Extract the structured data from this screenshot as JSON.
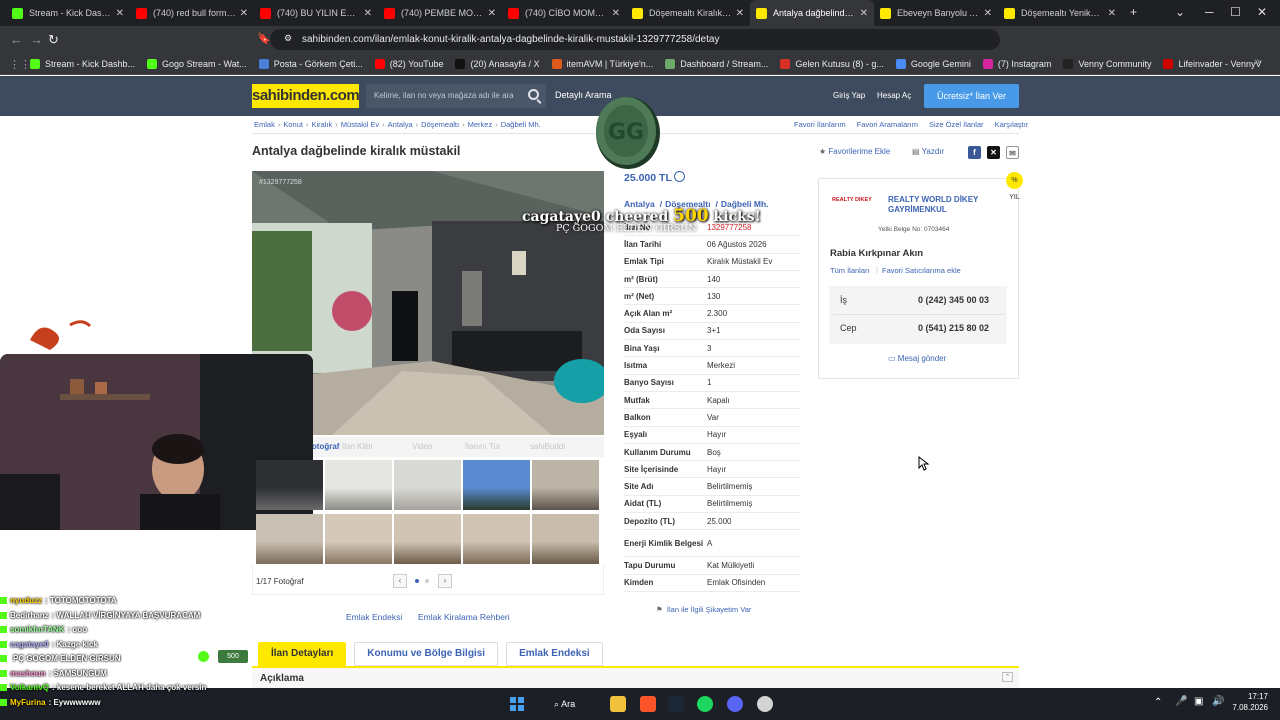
{
  "browser": {
    "tabs": [
      {
        "label": "Stream - Kick Dashboard",
        "icon": "kick-icon",
        "color": "#53fc18"
      },
      {
        "label": "(740) red bull formulaz -",
        "icon": "youtube-icon",
        "color": "#ff0000"
      },
      {
        "label": "(740) BU YILIN EN BÜYÜ",
        "icon": "youtube-icon",
        "color": "#ff0000"
      },
      {
        "label": "(740) PEMBE MONSTER |",
        "icon": "youtube-icon",
        "color": "#ff0000"
      },
      {
        "label": "(740) CİBO MOMENTS | U",
        "icon": "youtube-icon",
        "color": "#ff0000"
      },
      {
        "label": "Döşemealtı Kiralık Müstak",
        "icon": "sahibinden-icon",
        "color": "#ffe800"
      },
      {
        "label": "Antalya dağbelinde k",
        "icon": "sahibinden-icon",
        "color": "#ffe800",
        "active": true
      },
      {
        "label": "Ebeveyn Banyolu Alaturka",
        "icon": "sahibinden-icon",
        "color": "#ffe800"
      },
      {
        "label": "Döşemealtı Yeniköy'de 2",
        "icon": "sahibinden-icon",
        "color": "#ffe800"
      }
    ],
    "url": "sahibinden.com/ilan/emlak-konut-kiralik-antalya-dagbelinde-kiralik-mustakil-1329777258/detay",
    "bookmarks": [
      {
        "label": "Stream - Kick Dashb...",
        "color": "#53fc18"
      },
      {
        "label": "Gogo Stream - Wat...",
        "color": "#53fc18"
      },
      {
        "label": "Posta - Görkem Çeti...",
        "color": "#4a7fd8"
      },
      {
        "label": "(82) YouTube",
        "color": "#ff0000"
      },
      {
        "label": "(20) Anasayfa / X",
        "color": "#111111"
      },
      {
        "label": "itemAVM | Türkiye'n...",
        "color": "#e05a1a"
      },
      {
        "label": "Dashboard / Stream...",
        "color": "#6ea86a"
      },
      {
        "label": "Gelen Kutusu (8) - g...",
        "color": "#d93025"
      },
      {
        "label": "Google Gemini",
        "color": "#4b8bf5"
      },
      {
        "label": "(7) Instagram",
        "color": "#d6249f"
      },
      {
        "label": "Venny Community",
        "color": "#222222"
      },
      {
        "label": "Lifeinvader - VennyV",
        "color": "#d00000"
      }
    ]
  },
  "site": {
    "logo": "sahibinden.com",
    "search_placeholder": "Kelime, ilan no veya mağaza adı ile ara",
    "detailed_search": "Detaylı Arama",
    "login": "Giriş Yap",
    "register": "Hesap Aç",
    "post_ad": "Ücretsiz* İlan Ver",
    "breadcrumb": [
      "Emlak",
      "Konut",
      "Kiralık",
      "Müstakil Ev",
      "Antalya",
      "Döşemealtı",
      "Merkez",
      "Dağbeli Mh."
    ],
    "breadcrumb_right": [
      "Favori İlanlarım",
      "Favori Aramalarım",
      "Size Özel İlanlar",
      "Karşılaştır"
    ]
  },
  "listing": {
    "title": "Antalya dağbelinde kiralık müstakil",
    "add_favorite": "Favorilerime Ekle",
    "print": "Yazdır",
    "photo_watermark_id": "#1329777258",
    "photo_tabs": [
      "Fotoğraf",
      "İlan Klibi",
      "Video",
      "İlanını Tur",
      "sahiBuddi"
    ],
    "photo_counter": "1/17 Fotoğraf",
    "price": "25.000 TL",
    "location": [
      "Antalya",
      "Döşemealtı",
      "Dağbeli Mh."
    ],
    "details": [
      {
        "k": "İlan No",
        "v": "1329777258",
        "red": true
      },
      {
        "k": "İlan Tarihi",
        "v": "06 Ağustos 2026"
      },
      {
        "k": "Emlak Tipi",
        "v": "Kiralık Müstakil Ev"
      },
      {
        "k": "m² (Brüt)",
        "v": "140"
      },
      {
        "k": "m² (Net)",
        "v": "130"
      },
      {
        "k": "Açık Alan m²",
        "v": "2.300"
      },
      {
        "k": "Oda Sayısı",
        "v": "3+1"
      },
      {
        "k": "Bina Yaşı",
        "v": "3"
      },
      {
        "k": "Isıtma",
        "v": "Merkezi"
      },
      {
        "k": "Banyo Sayısı",
        "v": "1"
      },
      {
        "k": "Mutfak",
        "v": "Kapalı"
      },
      {
        "k": "Balkon",
        "v": "Var"
      },
      {
        "k": "Eşyalı",
        "v": "Hayır"
      },
      {
        "k": "Kullanım Durumu",
        "v": "Boş"
      },
      {
        "k": "Site İçerisinde",
        "v": "Hayır"
      },
      {
        "k": "Site Adı",
        "v": "Belirtilmemiş"
      },
      {
        "k": "Aidat (TL)",
        "v": "Belirtilmemiş"
      },
      {
        "k": "Depozito (TL)",
        "v": "25.000"
      },
      {
        "k": "Enerji Kimlik Belgesi",
        "v": "A",
        "tall": true
      },
      {
        "k": "Tapu Durumu",
        "v": "Kat Mülkiyetli"
      },
      {
        "k": "Kimden",
        "v": "Emlak Ofisinden"
      }
    ],
    "complaint": "İlan ile İlgili Şikayetim Var",
    "bottom_links": [
      "Emlak Endeksi",
      "Emlak Kiralama Rehberi"
    ],
    "detail_tabs": [
      "İlan Detayları",
      "Konumu ve Bölge Bilgisi",
      "Emlak Endeksi"
    ],
    "description_title": "Açıklama"
  },
  "seller": {
    "logo_text": "REALTY DIKEY",
    "name": "REALTY WORLD DİKEY GAYRİMENKUL",
    "certificate": "Yetki Belge No: 0703464",
    "agent": "Rabia Kırkpınar Akın",
    "all_ads": "Tüm İlanları",
    "add_fav_seller": "Favori Satıcılarıma ekle",
    "phones": [
      {
        "label": "İş",
        "number": "0 (242) 345 00 03"
      },
      {
        "label": "Cep",
        "number": "0 (541) 215 80 02"
      }
    ],
    "message": "Mesaj gönder",
    "badge": "% YIL"
  },
  "stream": {
    "cheer_user": "cagataye0",
    "cheer_verb": "cheered",
    "cheer_amount": "500",
    "cheer_unit": "kicks!",
    "cheer_sub": "PÇ GOGOM ELDEN GIRSUN",
    "chat": [
      {
        "user": "nyuduzz",
        "msg": ": TOTOMOTOTOTA",
        "color": "#ffd700"
      },
      {
        "user": "Bedirhanz",
        "msg": ": WALLAH VİRGİNYAYA BAŞVURACAM",
        "color": "#ffffff"
      },
      {
        "user": "somikfınTANK",
        "msg": ": ooo",
        "color": "#9aff9a"
      },
      {
        "user": "cagataye0",
        "msg": ": Kazge kick",
        "color": "#b4b4ff"
      },
      {
        "user": "",
        "msg": "PÇ GOGOM ELDEN GIRSUN",
        "color": "#ffffff"
      },
      {
        "user": "mashoun",
        "msg": ": SAMSUNGUM",
        "color": "#ff9ad5"
      },
      {
        "user": "VolkantvQ",
        "msg": ": kesene bereket ALLAH daha çok versin",
        "color": "#53fc18"
      },
      {
        "user": "MyFurina",
        "msg": ": Eywwwwww",
        "color": "#ffd700"
      }
    ],
    "cheer_badge": "500"
  },
  "taskbar": {
    "search": "Ara",
    "time": "17:17",
    "date": "7.08.2026"
  }
}
